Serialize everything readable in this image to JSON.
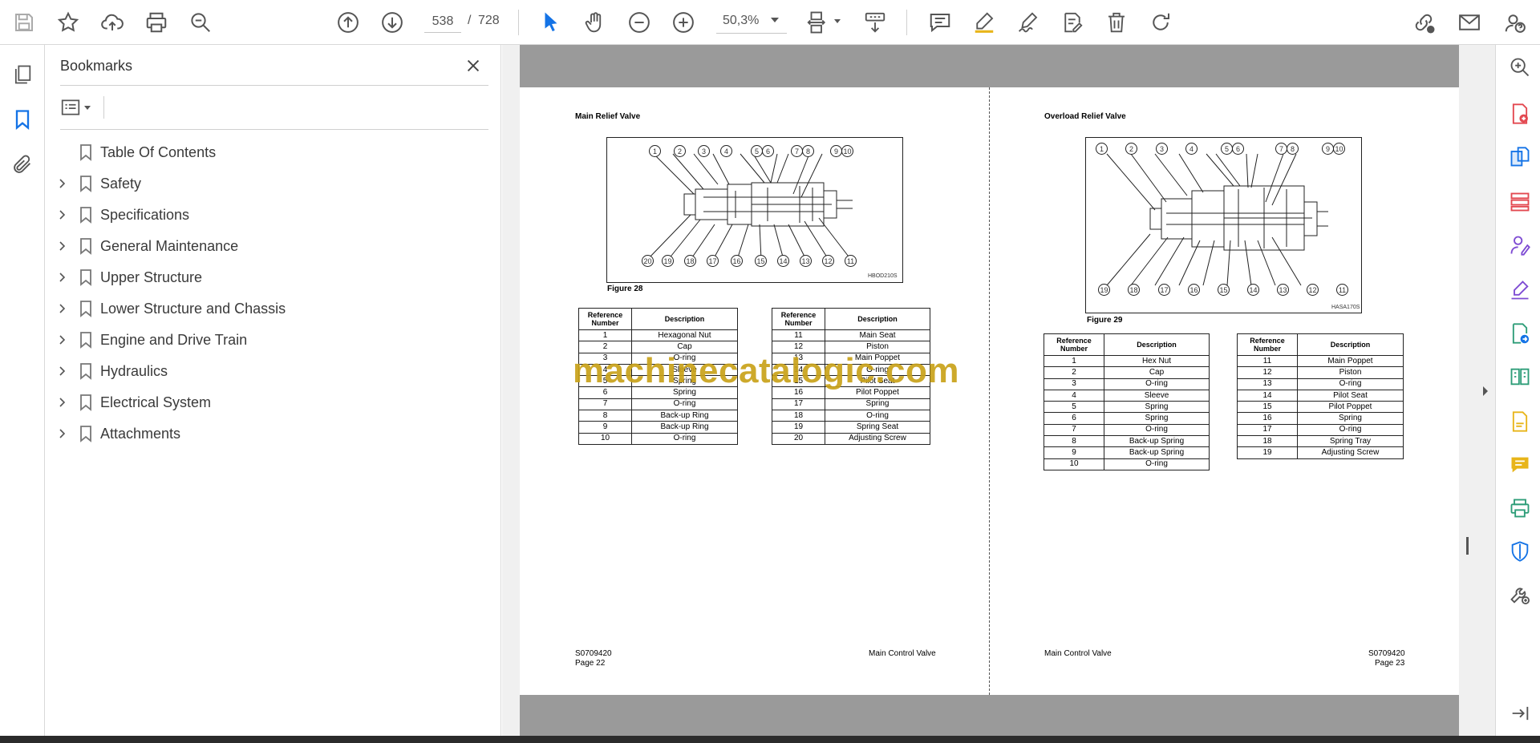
{
  "toolbar": {
    "page_current": "538",
    "page_separator": "/",
    "page_total": "728",
    "zoom": "50,3%"
  },
  "bookmarks": {
    "title": "Bookmarks",
    "items": [
      {
        "label": "Table Of Contents",
        "expandable": false
      },
      {
        "label": "Safety",
        "expandable": true
      },
      {
        "label": "Specifications",
        "expandable": true
      },
      {
        "label": "General Maintenance",
        "expandable": true
      },
      {
        "label": "Upper Structure",
        "expandable": true
      },
      {
        "label": "Lower Structure and Chassis",
        "expandable": true
      },
      {
        "label": "Engine and Drive Train",
        "expandable": true
      },
      {
        "label": "Hydraulics",
        "expandable": true
      },
      {
        "label": "Electrical System",
        "expandable": true
      },
      {
        "label": "Attachments",
        "expandable": true
      }
    ]
  },
  "document": {
    "watermark": "machinecatalogic.com",
    "left_page": {
      "section_title": "Main Relief Valve",
      "figure_caption": "Figure 28",
      "figure_code": "HBOD210S",
      "callouts_top": [
        "1",
        "2",
        "3",
        "4",
        "5",
        "6",
        "7",
        "8",
        "9",
        "10"
      ],
      "callouts_bottom": [
        "20",
        "19",
        "18",
        "17",
        "16",
        "15",
        "14",
        "13",
        "12",
        "11"
      ],
      "table_header": [
        "Reference Number",
        "Description"
      ],
      "table_a": [
        [
          "1",
          "Hexagonal Nut"
        ],
        [
          "2",
          "Cap"
        ],
        [
          "3",
          "O-ring"
        ],
        [
          "4",
          "Sleeve"
        ],
        [
          "5",
          "Spring"
        ],
        [
          "6",
          "Spring"
        ],
        [
          "7",
          "O-ring"
        ],
        [
          "8",
          "Back-up Ring"
        ],
        [
          "9",
          "Back-up Ring"
        ],
        [
          "10",
          "O-ring"
        ]
      ],
      "table_b": [
        [
          "11",
          "Main Seat"
        ],
        [
          "12",
          "Piston"
        ],
        [
          "13",
          "Main Poppet"
        ],
        [
          "14",
          "O-ring"
        ],
        [
          "15",
          "Pilot Seat"
        ],
        [
          "16",
          "Pilot Poppet"
        ],
        [
          "17",
          "Spring"
        ],
        [
          "18",
          "O-ring"
        ],
        [
          "19",
          "Spring Seat"
        ],
        [
          "20",
          "Adjusting Screw"
        ]
      ],
      "footer_code": "S0709420",
      "footer_page": "Page 22",
      "footer_title": "Main Control Valve"
    },
    "right_page": {
      "section_title": "Overload Relief Valve",
      "figure_caption": "Figure 29",
      "figure_code": "HASA170S",
      "callouts_top": [
        "1",
        "2",
        "3",
        "4",
        "5",
        "6",
        "7",
        "8",
        "9",
        "10"
      ],
      "callouts_bottom": [
        "19",
        "18",
        "17",
        "16",
        "15",
        "14",
        "13",
        "12",
        "11"
      ],
      "table_header": [
        "Reference Number",
        "Description"
      ],
      "table_a": [
        [
          "1",
          "Hex Nut"
        ],
        [
          "2",
          "Cap"
        ],
        [
          "3",
          "O-ring"
        ],
        [
          "4",
          "Sleeve"
        ],
        [
          "5",
          "Spring"
        ],
        [
          "6",
          "Spring"
        ],
        [
          "7",
          "O-ring"
        ],
        [
          "8",
          "Back-up Spring"
        ],
        [
          "9",
          "Back-up Spring"
        ],
        [
          "10",
          "O-ring"
        ]
      ],
      "table_b": [
        [
          "11",
          "Main Poppet"
        ],
        [
          "12",
          "Piston"
        ],
        [
          "13",
          "O-ring"
        ],
        [
          "14",
          "Pilot Seat"
        ],
        [
          "15",
          "Pilot Poppet"
        ],
        [
          "16",
          "Spring"
        ],
        [
          "17",
          "O-ring"
        ],
        [
          "18",
          "Spring Tray"
        ],
        [
          "19",
          "Adjusting Screw"
        ]
      ],
      "footer_title": "Main Control Valve",
      "footer_code": "S0709420",
      "footer_page": "Page 23"
    }
  },
  "icons": {
    "toolbar": [
      "save-icon",
      "star-icon",
      "upload-cloud-icon",
      "print-icon",
      "zoom-search-icon",
      "page-up-icon",
      "page-down-icon",
      "select-cursor-icon",
      "hand-icon",
      "zoom-out-icon",
      "zoom-in-icon",
      "page-fit-icon",
      "scroll-mode-icon",
      "comment-icon",
      "highlight-pen-icon",
      "sign-icon",
      "edit-form-icon",
      "delete-icon",
      "rotate-icon",
      "share-link-icon",
      "email-icon",
      "account-help-icon"
    ],
    "left_rail": [
      "page-thumbnails-icon",
      "bookmark-icon",
      "attachment-icon"
    ],
    "right_rail": [
      "search-zoom-icon",
      "export-pdf-icon",
      "create-pdf-icon",
      "organize-pages-icon",
      "request-signature-icon",
      "fill-sign-icon",
      "send-review-icon",
      "compare-files-icon",
      "scan-ocr-icon",
      "comment-tool-icon",
      "print-production-icon",
      "protect-icon",
      "more-tools-icon",
      "collapse-pane-icon"
    ],
    "accent_blue": "#1473e6",
    "accent_red": "#e34850",
    "accent_purple": "#7e4bd3",
    "accent_green": "#2d9d78",
    "accent_yellow": "#e8b51a"
  }
}
